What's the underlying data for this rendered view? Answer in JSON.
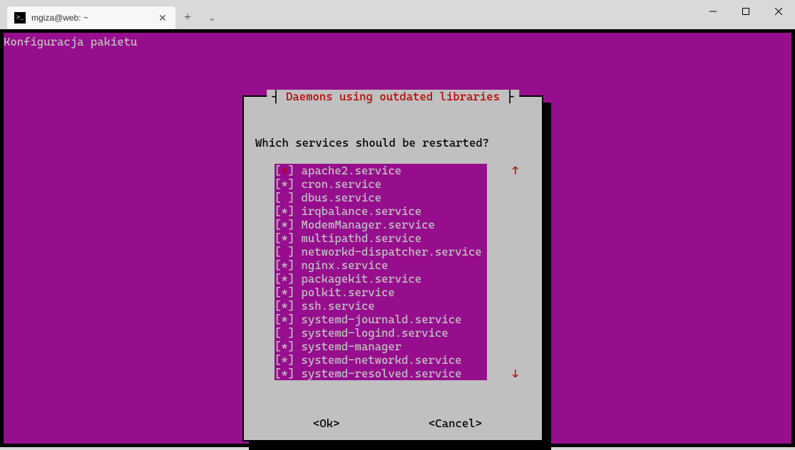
{
  "window": {
    "tab_label": "mgiza@web: ~",
    "tab_icon_glyph": "C:\\"
  },
  "terminal": {
    "header": "Konfiguracja pakietu"
  },
  "dialog": {
    "title": "Daemons using outdated libraries",
    "question": "Which services should be restarted?",
    "ok_label": "<Ok>",
    "cancel_label": "<Cancel>",
    "scroll_up_glyph": "↑",
    "scroll_down_glyph": "↓",
    "scroll_thumb_glyph": "▮",
    "checked_glyph": "*",
    "unchecked_glyph": " ",
    "services": [
      {
        "name": "apache2.service",
        "checked": true,
        "highlight": true
      },
      {
        "name": "cron.service",
        "checked": true
      },
      {
        "name": "dbus.service",
        "checked": false
      },
      {
        "name": "irqbalance.service",
        "checked": true
      },
      {
        "name": "ModemManager.service",
        "checked": true
      },
      {
        "name": "multipathd.service",
        "checked": true
      },
      {
        "name": "networkd-dispatcher.service",
        "checked": false
      },
      {
        "name": "nginx.service",
        "checked": true
      },
      {
        "name": "packagekit.service",
        "checked": true
      },
      {
        "name": "polkit.service",
        "checked": true
      },
      {
        "name": "ssh.service",
        "checked": true
      },
      {
        "name": "systemd-journald.service",
        "checked": true
      },
      {
        "name": "systemd-logind.service",
        "checked": false
      },
      {
        "name": "systemd-manager",
        "checked": true
      },
      {
        "name": "systemd-networkd.service",
        "checked": true
      },
      {
        "name": "systemd-resolved.service",
        "checked": true
      }
    ]
  }
}
